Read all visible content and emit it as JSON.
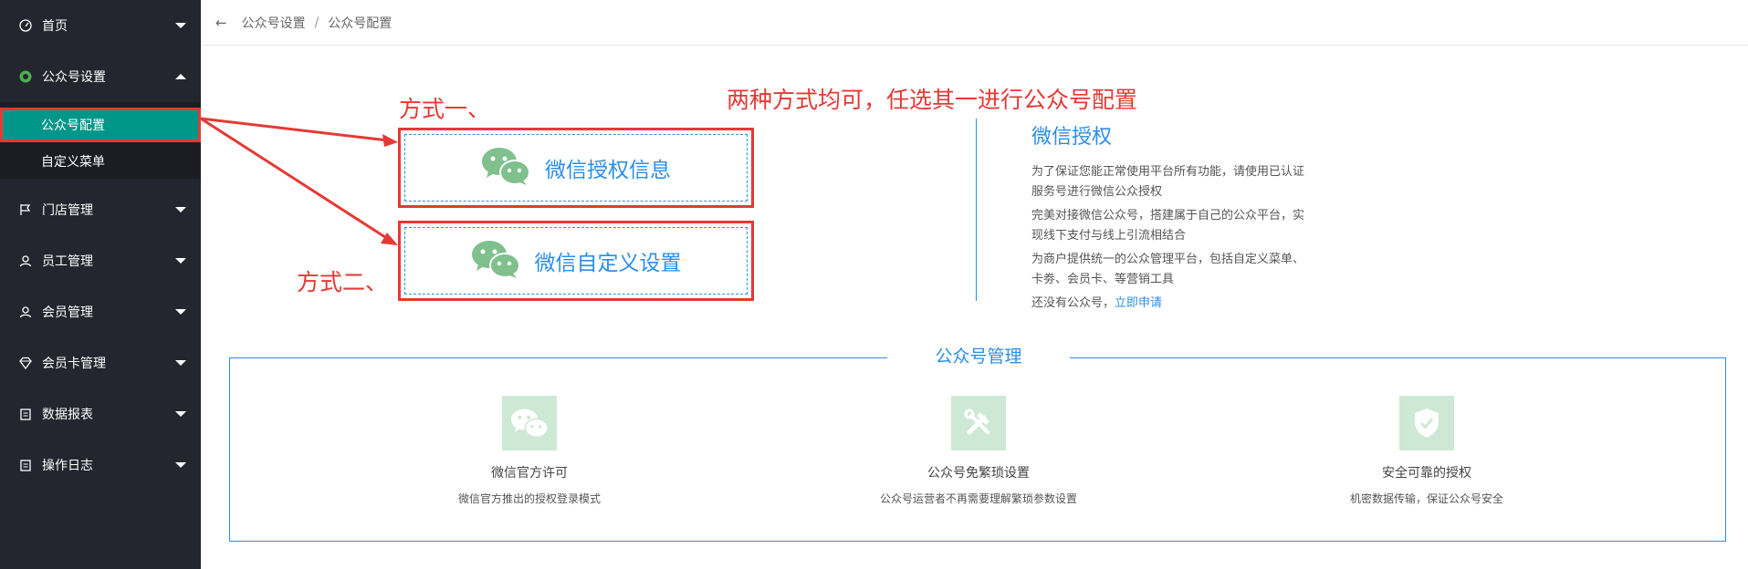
{
  "sidebar": {
    "items": [
      {
        "label": "首页",
        "icon": "dashboard-icon"
      },
      {
        "label": "公众号设置",
        "icon": "wechat-circle-icon"
      },
      {
        "label": "门店管理",
        "icon": "flag-icon"
      },
      {
        "label": "员工管理",
        "icon": "user-icon"
      },
      {
        "label": "会员管理",
        "icon": "user-icon"
      },
      {
        "label": "会员卡管理",
        "icon": "diamond-icon"
      },
      {
        "label": "数据报表",
        "icon": "clipboard-icon"
      },
      {
        "label": "操作日志",
        "icon": "clipboard-icon"
      }
    ],
    "submenu": [
      {
        "label": "公众号配置",
        "active": true
      },
      {
        "label": "自定义菜单",
        "active": false
      }
    ],
    "accent": "#009688"
  },
  "header": {
    "back": "←",
    "breadcrumb": [
      "公众号设置",
      "公众号配置"
    ],
    "separator": "/"
  },
  "annotations": {
    "method_one": "方式一、",
    "method_two": "方式二、",
    "note": "两种方式均可，任选其一进行公众号配置",
    "color": "#e53935"
  },
  "options": {
    "auth_info": "微信授权信息",
    "custom_settings": "微信自定义设置"
  },
  "info": {
    "title": "微信授权",
    "p1": "为了保证您能正常使用平台所有功能，请使用已认证服务号进行微信公众授权",
    "p2": "完美对接微信公众号，搭建属于自己的公众平台，实现线下支付与线上引流相结合",
    "p3": "为商户提供统一的公众管理平台，包括自定义菜单、卡劵、会员卡、等营销工具",
    "p4_prefix": "还没有公众号，",
    "p4_link": "立即申请"
  },
  "management": {
    "title": "公众号管理",
    "features": [
      {
        "title": "微信官方许可",
        "desc": "微信官方推出的授权登录模式",
        "icon": "wechat-icon"
      },
      {
        "title": "公众号免繁琐设置",
        "desc": "公众号运营者不再需要理解繁琐参数设置",
        "icon": "tools-icon"
      },
      {
        "title": "安全可靠的授权",
        "desc": "机密数据传输，保证公众号安全",
        "icon": "shield-check-icon"
      }
    ]
  },
  "colors": {
    "blue": "#2b8ee8",
    "sidebar_bg": "#23262e",
    "wechat_green": "#7fc08d"
  }
}
